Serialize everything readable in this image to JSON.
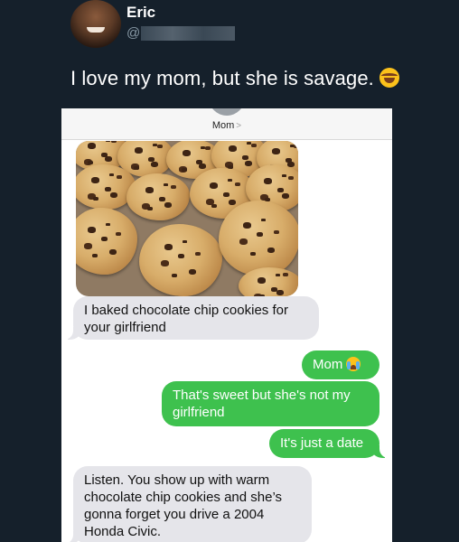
{
  "tweet": {
    "author_name": "Eric",
    "handle_prefix": "@",
    "text": "I love my mom, but she is  savage.",
    "emoji": "face-with-tears-of-joy"
  },
  "messages_screenshot": {
    "contact_name": "Mom",
    "contact_chevron": ">",
    "photo_icon": "chocolate-chip-cookies-photo",
    "messages": [
      {
        "from": "mom",
        "text": "I baked chocolate chip cookies for your girlfriend"
      },
      {
        "from": "me",
        "text": "Mom",
        "emoji": "crying-face"
      },
      {
        "from": "me",
        "text": "That's sweet but she's not my girlfriend"
      },
      {
        "from": "me",
        "text": "It's just a date"
      },
      {
        "from": "mom",
        "text": "Listen. You show up with warm chocolate chip cookies and she’s gonna forget you drive a 2004 Honda Civic."
      }
    ]
  },
  "colors": {
    "background": "#15202b",
    "incoming_bubble": "#e5e5ea",
    "outgoing_bubble": "#3ec14e"
  }
}
